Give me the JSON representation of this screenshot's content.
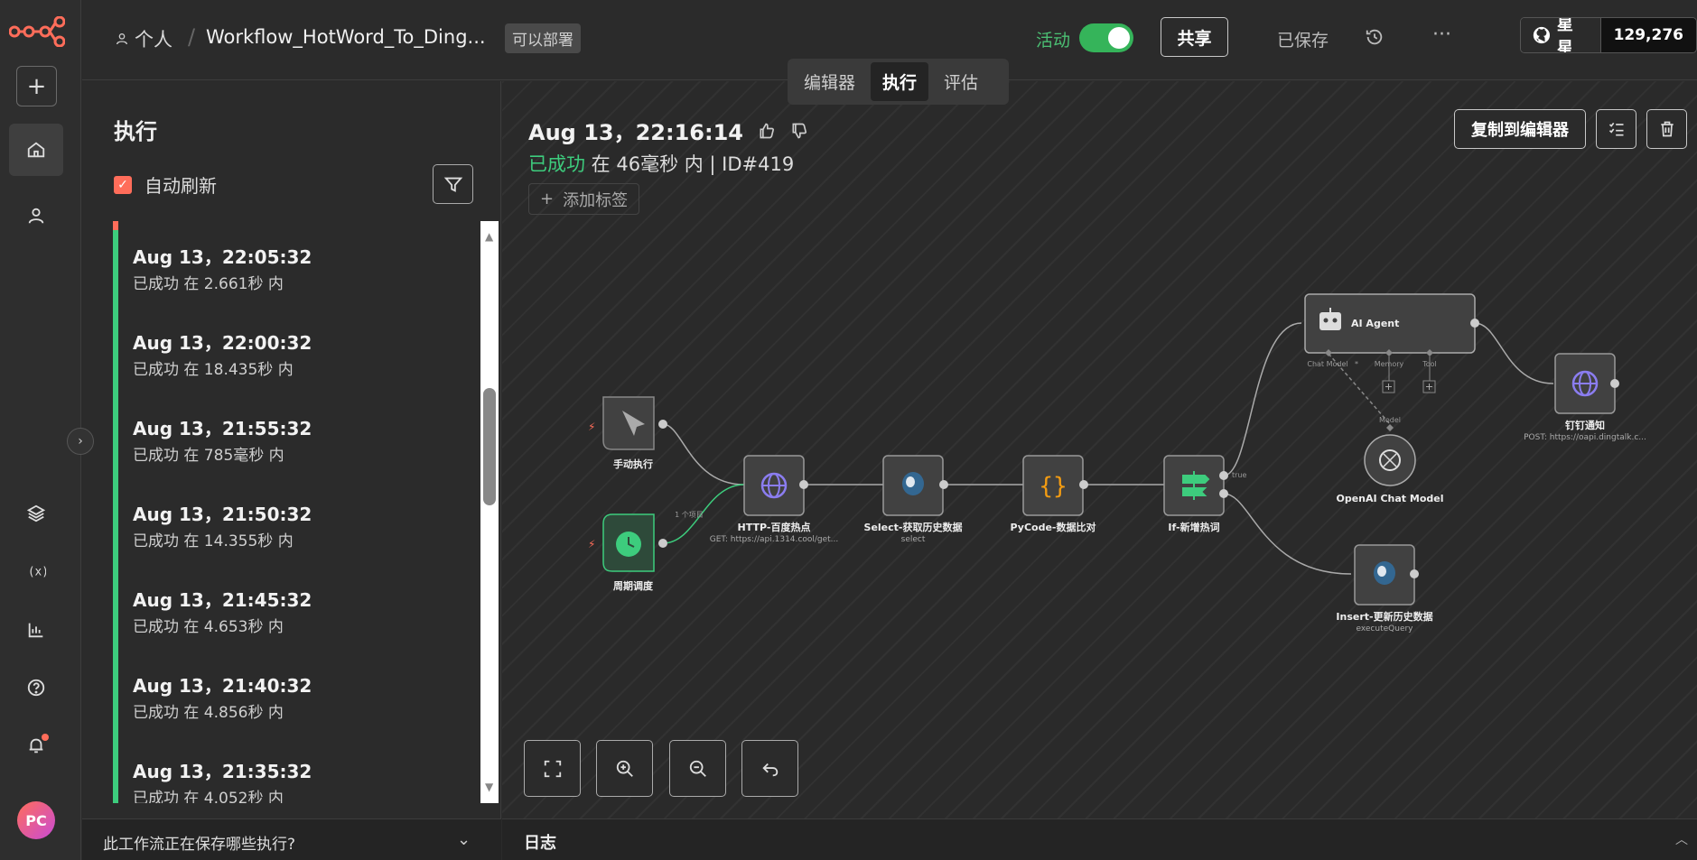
{
  "topbar": {
    "owner": "个人",
    "workflow_name": "Workflow_HotWord_To_Ding...",
    "deploy_badge": "可以部署",
    "active_label": "活动",
    "share_label": "共享",
    "saved_label": "已保存",
    "star_label": "星星",
    "star_count": "129,276"
  },
  "tabs": [
    {
      "label": "编辑器"
    },
    {
      "label": "执行"
    },
    {
      "label": "评估"
    }
  ],
  "executions": {
    "title": "执行",
    "auto_refresh_label": "自动刷新",
    "items": [
      {
        "date": "Aug 13，22:05:32",
        "status": "已成功 在 2.661秒 内"
      },
      {
        "date": "Aug 13，22:00:32",
        "status": "已成功 在 18.435秒 内"
      },
      {
        "date": "Aug 13，21:55:32",
        "status": "已成功 在 785毫秒 内"
      },
      {
        "date": "Aug 13，21:50:32",
        "status": "已成功 在 14.355秒 内"
      },
      {
        "date": "Aug 13，21:45:32",
        "status": "已成功 在 4.653秒 内"
      },
      {
        "date": "Aug 13，21:40:32",
        "status": "已成功 在 4.856秒 内"
      },
      {
        "date": "Aug 13，21:35:32",
        "status": "已成功 在 4.052秒 内"
      }
    ],
    "saving_question": "此工作流正在保存哪些执行?"
  },
  "run": {
    "title": "Aug 13，22:16:14",
    "status_ok": "已成功",
    "status_rest": " 在 46毫秒 内 | ID#419",
    "add_tag": "添加标签",
    "copy_label": "复制到编辑器"
  },
  "nodes": {
    "manual": {
      "label": "手动执行"
    },
    "schedule": {
      "label": "周期调度"
    },
    "http": {
      "label": "HTTP-百度热点",
      "sub": "GET: https://api.1314.cool/get..."
    },
    "select": {
      "label": "Select-获取历史数据",
      "sub": "select"
    },
    "pycode": {
      "label": "PyCode-数据比对"
    },
    "ifnode": {
      "label": "If-新增热词",
      "branch": "true"
    },
    "agent": {
      "label": "AI Agent",
      "chat_model": "Chat Model",
      "memory": "Memory",
      "tool": "Tool"
    },
    "openai": {
      "label": "OpenAI Chat Model",
      "port": "Model"
    },
    "insert": {
      "label": "Insert-更新历史数据",
      "sub": "executeQuery"
    },
    "ding": {
      "label": "钉钉通知",
      "sub": "POST: https://oapi.dingtalk.c..."
    },
    "edge_items": "1 个项目"
  },
  "log": {
    "label": "日志"
  },
  "user": {
    "initials": "PC"
  },
  "colors": {
    "accent": "#ff6d5a",
    "success": "#3dcc7d",
    "toggle": "#35b45a"
  }
}
